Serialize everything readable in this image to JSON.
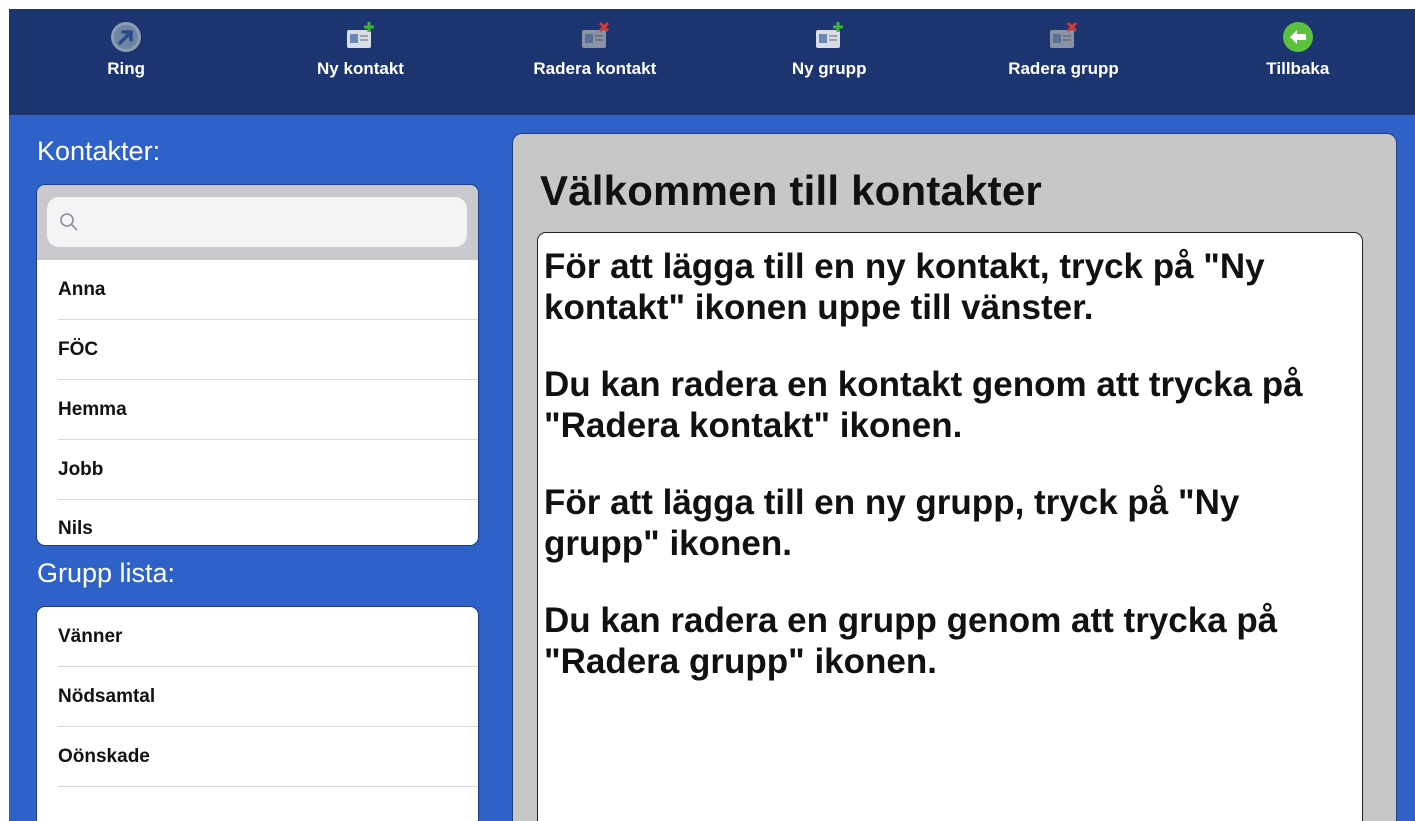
{
  "toolbar": {
    "items": [
      {
        "label": "Ring",
        "icon": "call-icon"
      },
      {
        "label": "Ny kontakt",
        "icon": "add-contact-icon"
      },
      {
        "label": "Radera kontakt",
        "icon": "delete-contact-icon"
      },
      {
        "label": "Ny grupp",
        "icon": "add-group-icon"
      },
      {
        "label": "Radera grupp",
        "icon": "delete-group-icon"
      },
      {
        "label": "Tillbaka",
        "icon": "back-arrow-icon"
      }
    ]
  },
  "contacts": {
    "title": "Kontakter:",
    "search_placeholder": "",
    "items": [
      "Anna",
      "FÖC",
      "Hemma",
      "Jobb",
      "Nils"
    ]
  },
  "groups": {
    "title": "Grupp lista:",
    "items": [
      "Vänner",
      "Nödsamtal",
      "Oönskade",
      ""
    ]
  },
  "info": {
    "title": "Välkommen till kontakter",
    "paragraphs": [
      "För att lägga till en ny kontakt, tryck på \"Ny kontakt\" ikonen uppe till vänster.",
      "Du kan radera en kontakt genom att trycka på \"Radera kontakt\" ikonen.",
      "För att lägga till en ny grupp, tryck på \"Ny grupp\" ikonen.",
      "Du kan radera en grupp genom att trycka på \"Radera grupp\" ikonen."
    ]
  },
  "colors": {
    "toolbar_bg": "#1c3470",
    "app_bg": "#2f62c9",
    "info_panel_bg": "#c7c7c7",
    "back_icon": "#5cc13c",
    "add_plus": "#3fb23a",
    "delete_x": "#d63a3a"
  }
}
